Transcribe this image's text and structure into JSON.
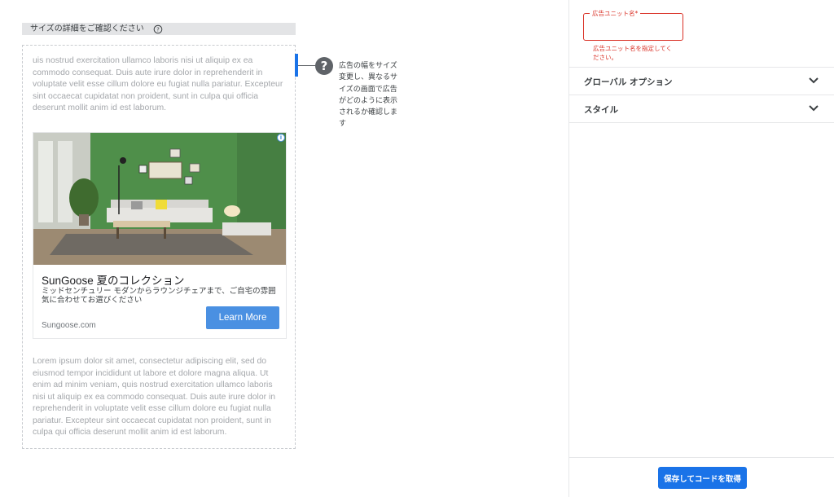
{
  "preview": {
    "header_title": "サイズの詳細をご確認ください",
    "lorem_top": "uis nostrud exercitation ullamco laboris nisi ut aliquip ex ea commodo consequat. Duis aute irure dolor in reprehenderit in voluptate velit esse cillum dolore eu fugiat nulla pariatur. Excepteur sint occaecat cupidatat non proident, sunt in culpa qui officia deserunt mollit anim id est laborum.",
    "lorem_bottom": "Lorem ipsum dolor sit amet, consectetur adipiscing elit, sed do eiusmod tempor incididunt ut labore et dolore magna aliqua. Ut enim ad minim veniam, quis nostrud exercitation ullamco laboris nisi ut aliquip ex ea commodo consequat. Duis aute irure dolor in reprehenderit in voluptate velit esse cillum dolore eu fugiat nulla pariatur. Excepteur sint occaecat cupidatat non proident, sunt in culpa qui officia deserunt mollit anim id est laborum.",
    "ad": {
      "title": "SunGoose 夏のコレクション",
      "description": "ミッドセンチュリー モダンからラウンジチェアまで、ご自宅の雰囲気に合わせてお選びください",
      "domain": "Sungoose.com",
      "cta": "Learn More",
      "choices_icon": "i"
    },
    "callout": {
      "icon": "?",
      "text": "広告の幅をサイズ変更し、異なるサイズの画面で広告がどのように表示されるか確認します"
    }
  },
  "panel": {
    "ad_unit_name_label": "広告ユニット名*",
    "ad_unit_name_value": "",
    "error": "広告ユニット名を指定してください。",
    "sections": [
      {
        "label": "グローバル オプション"
      },
      {
        "label": "スタイル"
      }
    ],
    "save_label": "保存してコードを取得"
  },
  "colors": {
    "accent": "#1a73e8",
    "error": "#d93025",
    "cta": "#4a90e2",
    "header_bg": "#e3e4e6"
  }
}
